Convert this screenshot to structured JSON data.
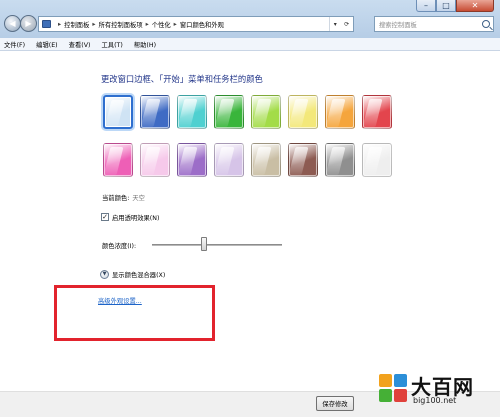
{
  "address_bar": {
    "crumbs": [
      "控制面板",
      "所有控制面板项",
      "个性化",
      "窗口颜色和外观"
    ],
    "search_placeholder": "搜索控制面板"
  },
  "menu": [
    "文件(F)",
    "编辑(E)",
    "查看(V)",
    "工具(T)",
    "帮助(H)"
  ],
  "main": {
    "heading": "更改窗口边框、「开始」菜单和任务栏的颜色",
    "swatches": [
      {
        "name": "sky",
        "color": "#cfe3f4",
        "selected": true
      },
      {
        "name": "twilight",
        "color": "#3f6bc4"
      },
      {
        "name": "sea",
        "color": "#4fd0d0"
      },
      {
        "name": "leaf",
        "color": "#39b53b"
      },
      {
        "name": "lime",
        "color": "#a3dc48"
      },
      {
        "name": "lemon",
        "color": "#f3e87a"
      },
      {
        "name": "pumpkin",
        "color": "#f5a53c"
      },
      {
        "name": "ruby",
        "color": "#e3454d"
      },
      {
        "name": "fuchsia",
        "color": "#ee5fb6"
      },
      {
        "name": "blush",
        "color": "#f6c9ea"
      },
      {
        "name": "violet",
        "color": "#9c6dc8"
      },
      {
        "name": "lavender",
        "color": "#d6c4e8"
      },
      {
        "name": "taupe",
        "color": "#c9bea4"
      },
      {
        "name": "chocolate",
        "color": "#8d5b52"
      },
      {
        "name": "slate",
        "color": "#8f8f8f"
      },
      {
        "name": "frost",
        "color": "#eeeeee"
      }
    ],
    "current_color_label": "当前颜色:",
    "current_color_value": "天空",
    "transparency_label": "启用透明效果(N)",
    "transparency_checked": true,
    "intensity_label": "颜色浓度(I):",
    "intensity_level_percent": 40,
    "mixer_label": "显示颜色混合器(X)",
    "advanced_link": "高级外观设置..."
  },
  "footer": {
    "save_label": "保存修改"
  },
  "watermark": {
    "title": "大百网",
    "url": "big100.net"
  },
  "colors": {
    "highlight_box": "#e2232d",
    "link": "#1d64c8",
    "heading": "#1e3287"
  }
}
